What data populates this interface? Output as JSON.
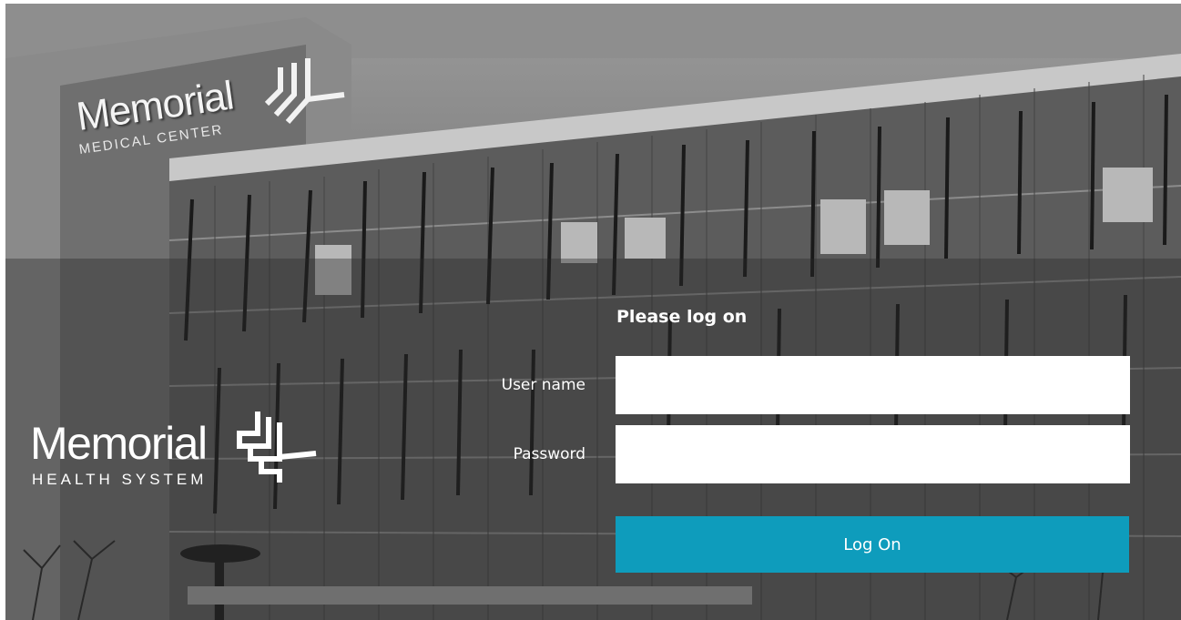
{
  "background": {
    "building_sign": {
      "word": "Memorial",
      "sub": "MEDICAL CENTER"
    }
  },
  "brand": {
    "word": "Memorial",
    "sub": "HEALTH SYSTEM"
  },
  "login": {
    "title": "Please log on",
    "username_label": "User name",
    "username_value": "",
    "password_label": "Password",
    "password_value": "",
    "submit_label": "Log On"
  },
  "colors": {
    "accent": "#0e9cbc",
    "band": "rgba(40,40,40,0.38)"
  },
  "icons": [
    "memorial-logo-icon"
  ]
}
